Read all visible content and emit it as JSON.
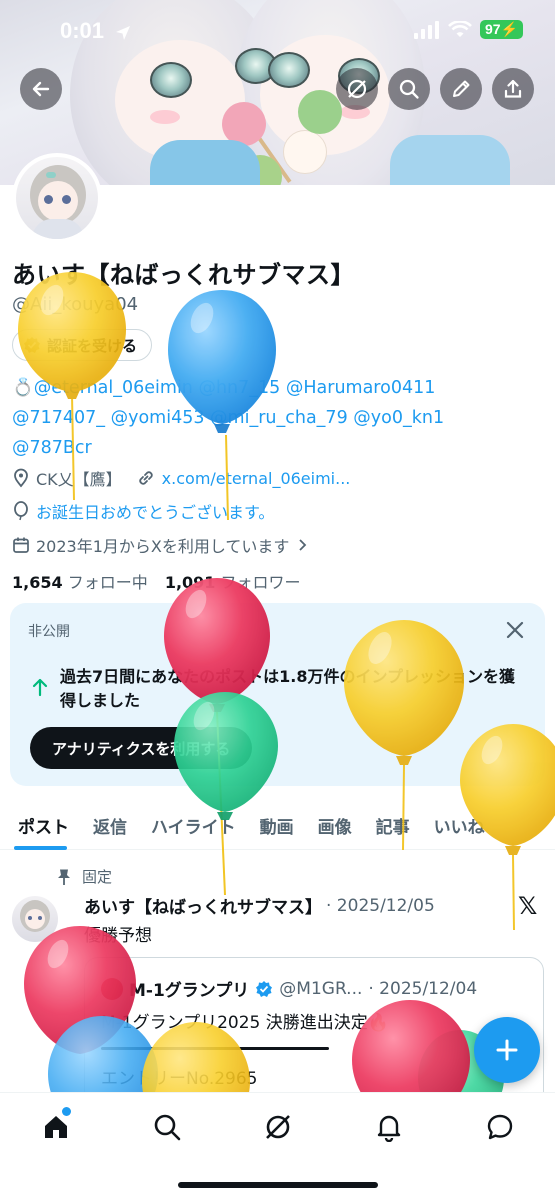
{
  "status_bar": {
    "time": "0:01",
    "battery": "97"
  },
  "header": {
    "back_icon": "arrow-left-icon",
    "grok_icon": "slashed-circle-icon",
    "search_icon": "search-icon",
    "edit_icon": "pencil-icon",
    "share_icon": "share-upload-icon"
  },
  "profile": {
    "name": "あいす【ねばっくれサブマス】",
    "handle": "@Aii_kouya04",
    "verify_label": "認証を受ける",
    "bio_line1_prefix": "💍",
    "bio_line1": "@eternal_06eimin @hn7_15 @Harumaro0411",
    "bio_line2": "@717407_ @yomi453 @mi_ru_cha_79 @yo0_kn1",
    "bio_line3": "@787Bcr",
    "location": "CK乂【鷹】",
    "website": "x.com/eternal_06eimi...",
    "birthday": "お誕生日おめでとうございます。",
    "joined": "2023年1月からXを利用しています",
    "following_count": "1,654",
    "following_label": "フォロー中",
    "followers_count": "1,091",
    "followers_label": "フォロワー"
  },
  "private_card": {
    "label": "非公開",
    "message": "過去7日間にあなたのポストは1.8万件のインプレッションを獲得しました",
    "cta": "アナリティクスを利用する"
  },
  "tabs": [
    "ポスト",
    "返信",
    "ハイライト",
    "動画",
    "画像",
    "記事",
    "いいね"
  ],
  "active_tab": "ポスト",
  "post": {
    "pinned_label": "固定",
    "author": "あいす【ねばっくれサブマス】",
    "date": "· 2025/12/05",
    "text": "優勝予想",
    "quote": {
      "author": "M-1グランプリ",
      "handle": "@M1GR...",
      "date": "· 2025/12/04",
      "text": "M-1グランプリ2025 決勝進出決定🔥",
      "subtext": "エントリーNo.2965"
    }
  },
  "bottom_nav": {
    "items": [
      "home-icon",
      "search-icon",
      "grok-icon",
      "bell-icon",
      "messages-icon"
    ]
  },
  "colors": {
    "accent": "#1d9bf0",
    "text_primary": "#0f1419",
    "text_secondary": "#536471",
    "balloon_yellow": "#f5c518",
    "balloon_blue": "#3aa7f0",
    "balloon_red": "#e8264f",
    "balloon_green": "#22c98a"
  }
}
